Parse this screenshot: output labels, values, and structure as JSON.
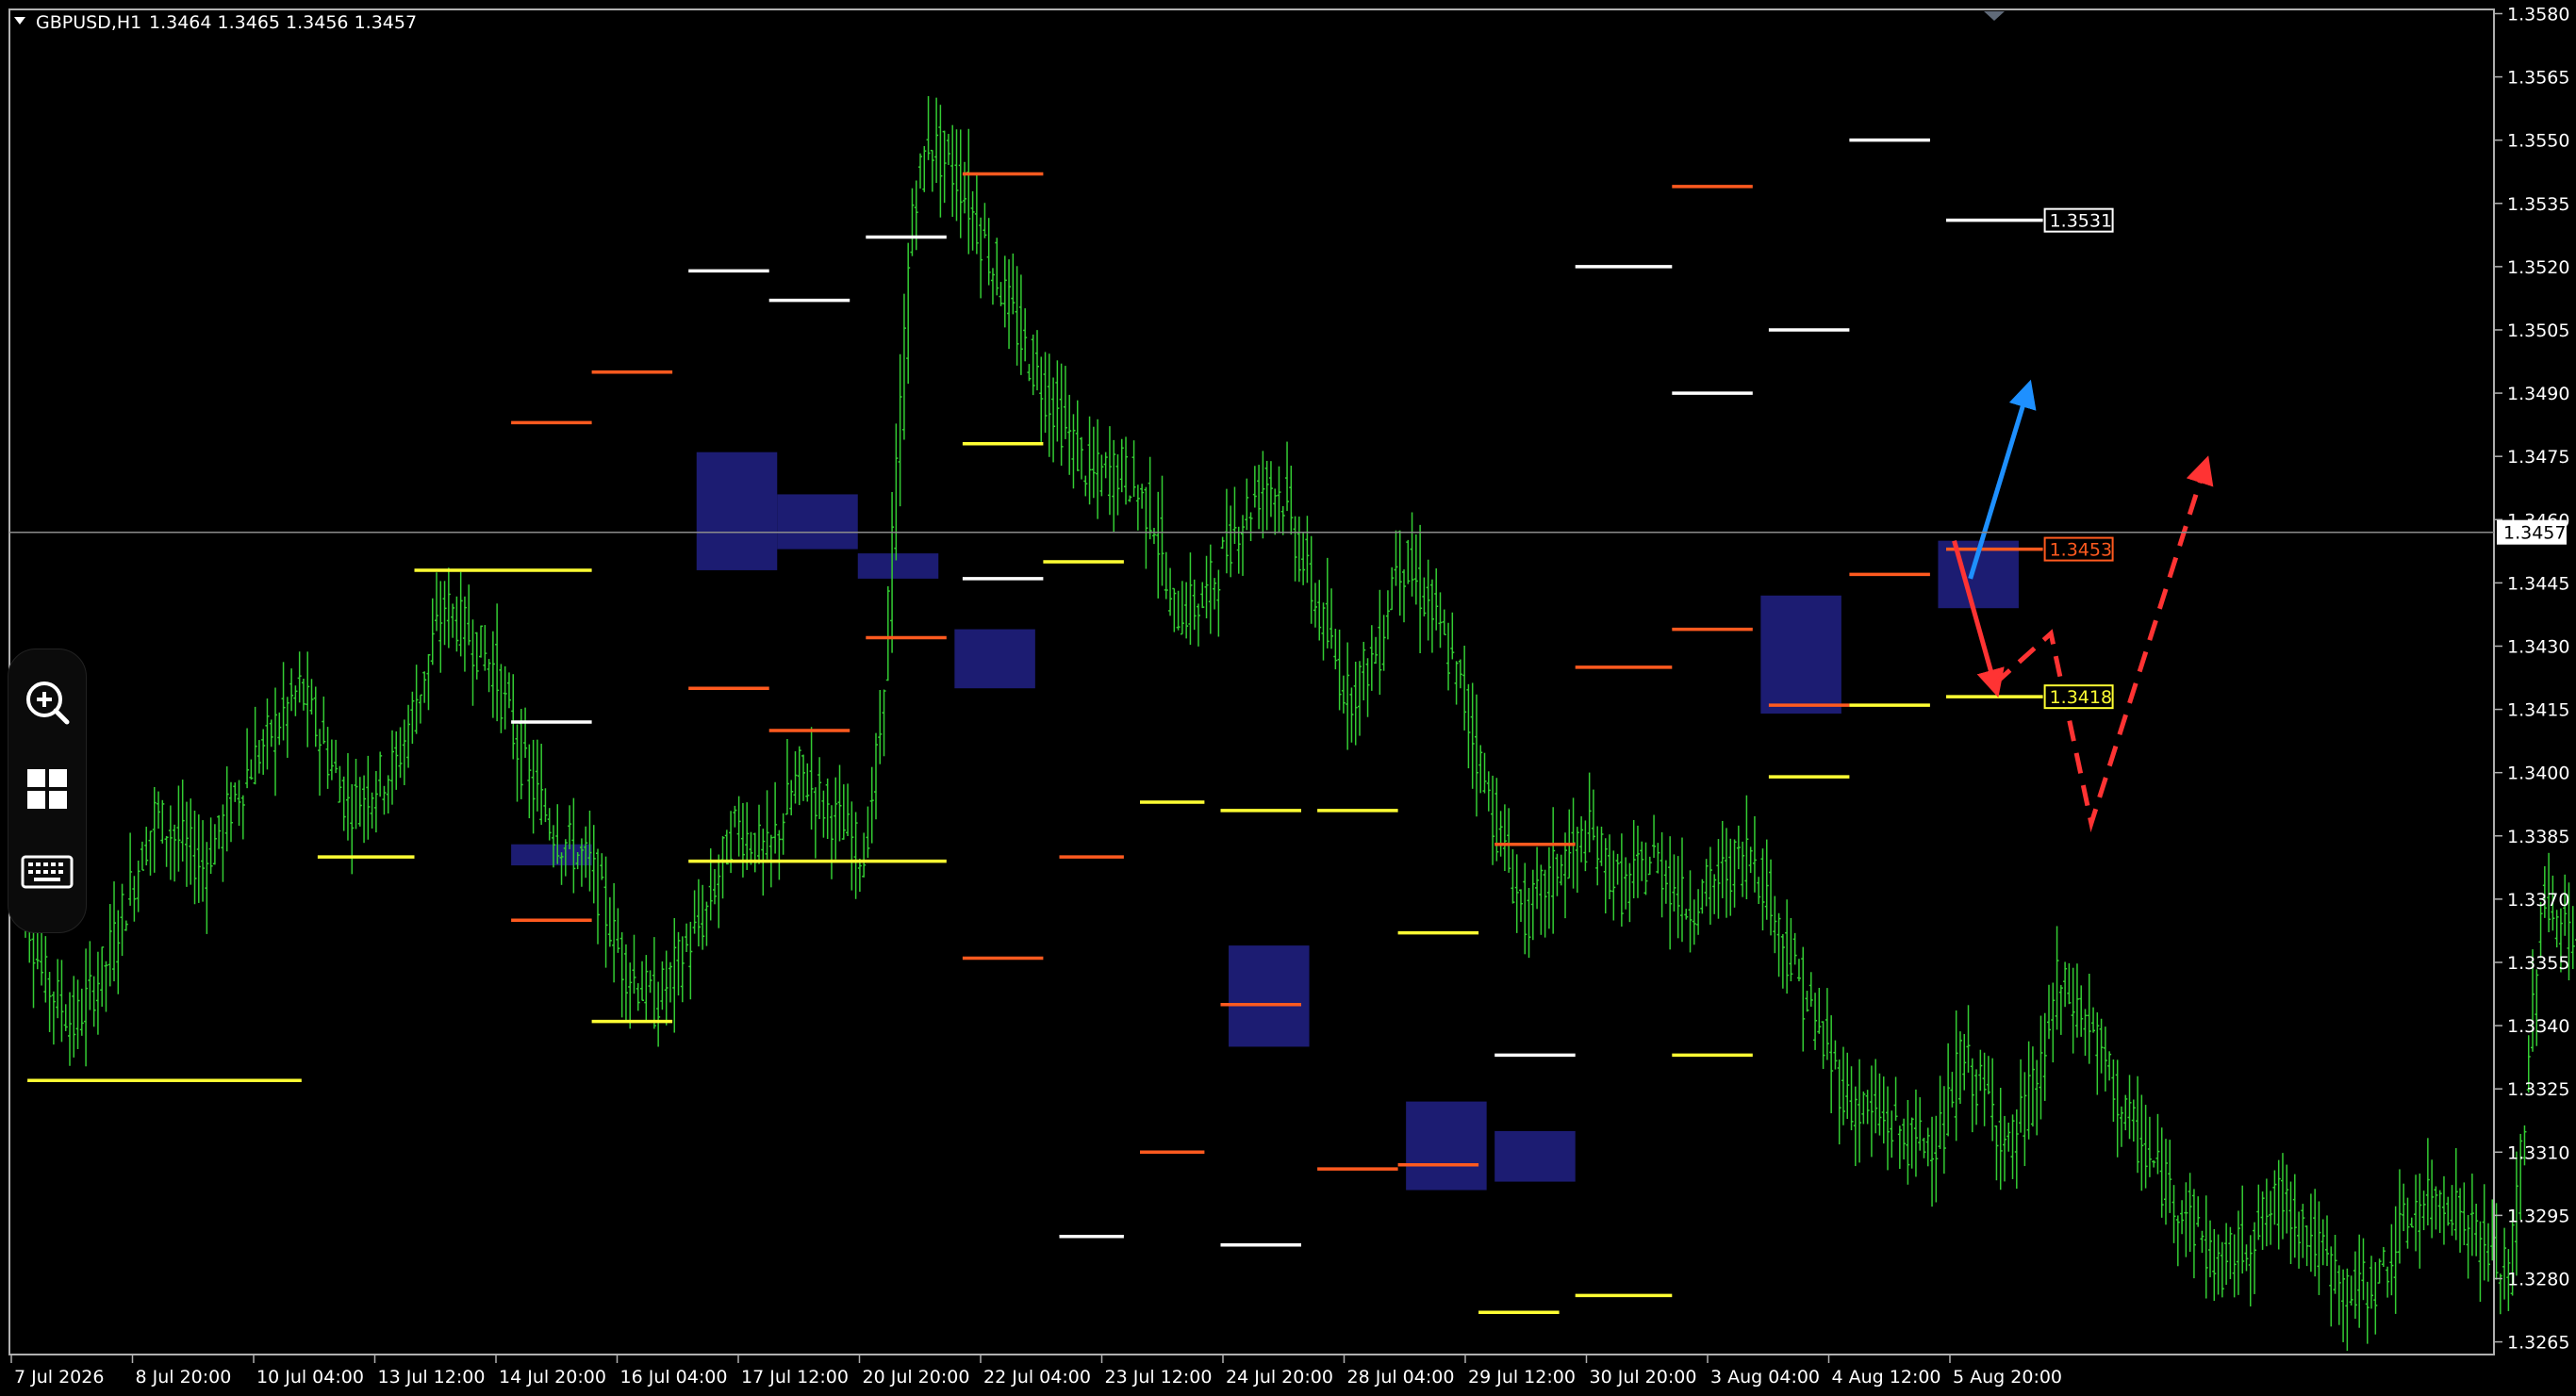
{
  "header": {
    "symbol_label": "GBPUSD,H1",
    "ohlc": "1.3464 1.3465 1.3456 1.3457"
  },
  "toolbar": {
    "icons": [
      "zoom-in-icon",
      "grid-icon",
      "keyboard-icon"
    ]
  },
  "chart_data": {
    "type": "candlestick",
    "symbol": "GBPUSD",
    "timeframe": "H1",
    "ohlc_last": {
      "open": 1.3464,
      "high": 1.3465,
      "low": 1.3456,
      "close": 1.3457
    },
    "ylim": [
      1.3262,
      1.3581
    ],
    "y_ticks": [
      "1.3580",
      "1.3565",
      "1.3550",
      "1.3535",
      "1.3520",
      "1.3505",
      "1.3490",
      "1.3475",
      "1.3460",
      "1.3445",
      "1.3430",
      "1.3415",
      "1.3400",
      "1.3385",
      "1.3370",
      "1.3355",
      "1.3340",
      "1.3325",
      "1.3310",
      "1.3295",
      "1.3280",
      "1.3265"
    ],
    "x_ticks": [
      "7 Jul 2026",
      "8 Jul 20:00",
      "10 Jul 04:00",
      "13 Jul 12:00",
      "14 Jul 20:00",
      "16 Jul 04:00",
      "17 Jul 12:00",
      "20 Jul 20:00",
      "22 Jul 04:00",
      "23 Jul 12:00",
      "24 Jul 20:00",
      "28 Jul 04:00",
      "29 Jul 12:00",
      "30 Jul 20:00",
      "3 Aug 04:00",
      "4 Aug 12:00",
      "5 Aug 20:00"
    ],
    "current_price": {
      "value": 1.3457,
      "label": "1.3457"
    },
    "price_labels": [
      {
        "value": 1.3531,
        "label": "1.3531",
        "color": "#ffffff"
      },
      {
        "value": 1.3453,
        "label": "1.3453",
        "color": "#ff5a1f"
      },
      {
        "value": 1.3418,
        "label": "1.3418",
        "color": "#ffff33"
      }
    ],
    "colors": {
      "candles": "#33cc33",
      "resistance": "#ffffff",
      "pivot": "#ff5a1f",
      "support": "#ffff33",
      "zones": "#1e1e78",
      "up_arrow": "#1e90ff",
      "down_arrow": "#ff3333"
    },
    "price_path": [
      [
        0,
        1.3385
      ],
      [
        2,
        1.3352
      ],
      [
        4,
        1.334
      ],
      [
        6,
        1.3355
      ],
      [
        9,
        1.339
      ],
      [
        12,
        1.3378
      ],
      [
        15,
        1.3402
      ],
      [
        18,
        1.342
      ],
      [
        21,
        1.3392
      ],
      [
        24,
        1.3402
      ],
      [
        27,
        1.344
      ],
      [
        30,
        1.3425
      ],
      [
        32,
        1.34
      ],
      [
        34,
        1.3385
      ],
      [
        36,
        1.3378
      ],
      [
        38,
        1.3355
      ],
      [
        40,
        1.3345
      ],
      [
        43,
        1.3365
      ],
      [
        45,
        1.3388
      ],
      [
        47,
        1.338
      ],
      [
        49,
        1.34
      ],
      [
        51,
        1.339
      ],
      [
        53,
        1.338
      ],
      [
        54,
        1.341
      ],
      [
        55,
        1.347
      ],
      [
        56,
        1.3535
      ],
      [
        57,
        1.355
      ],
      [
        59,
        1.354
      ],
      [
        61,
        1.352
      ],
      [
        63,
        1.35
      ],
      [
        65,
        1.3485
      ],
      [
        67,
        1.347
      ],
      [
        69,
        1.3472
      ],
      [
        71,
        1.346
      ],
      [
        72,
        1.3438
      ],
      [
        74,
        1.344
      ],
      [
        76,
        1.3458
      ],
      [
        78,
        1.347
      ],
      [
        79,
        1.3465
      ],
      [
        81,
        1.344
      ],
      [
        83,
        1.3418
      ],
      [
        85,
        1.343
      ],
      [
        86,
        1.3452
      ],
      [
        88,
        1.344
      ],
      [
        90,
        1.342
      ],
      [
        92,
        1.339
      ],
      [
        94,
        1.3365
      ],
      [
        96,
        1.3378
      ],
      [
        98,
        1.3385
      ],
      [
        100,
        1.3372
      ],
      [
        102,
        1.338
      ],
      [
        104,
        1.3368
      ],
      [
        106,
        1.3375
      ],
      [
        108,
        1.3382
      ],
      [
        110,
        1.336
      ],
      [
        112,
        1.334
      ],
      [
        114,
        1.3322
      ],
      [
        116,
        1.3318
      ],
      [
        118,
        1.3312
      ],
      [
        120,
        1.3315
      ],
      [
        121,
        1.3333
      ],
      [
        123,
        1.332
      ],
      [
        124,
        1.331
      ],
      [
        126,
        1.333
      ],
      [
        127,
        1.335
      ],
      [
        129,
        1.334
      ],
      [
        131,
        1.332
      ],
      [
        133,
        1.3306
      ],
      [
        135,
        1.3296
      ],
      [
        137,
        1.3282
      ],
      [
        139,
        1.329
      ],
      [
        141,
        1.33
      ],
      [
        143,
        1.3288
      ],
      [
        145,
        1.3276
      ],
      [
        147,
        1.328
      ],
      [
        149,
        1.3296
      ],
      [
        151,
        1.33
      ],
      [
        153,
        1.329
      ],
      [
        155,
        1.328
      ],
      [
        156,
        1.332
      ],
      [
        157,
        1.337
      ],
      [
        158,
        1.3365
      ],
      [
        159,
        1.336
      ],
      [
        160,
        1.3345
      ],
      [
        162,
        1.334
      ],
      [
        163,
        1.336
      ],
      [
        165,
        1.339
      ],
      [
        166,
        1.3435
      ],
      [
        168,
        1.347
      ],
      [
        170,
        1.346
      ],
      [
        172,
        1.3452
      ],
      [
        174,
        1.344
      ],
      [
        175,
        1.346
      ],
      [
        177,
        1.343
      ],
      [
        178,
        1.341
      ],
      [
        179,
        1.344
      ],
      [
        181,
        1.346
      ],
      [
        183,
        1.3478
      ],
      [
        185,
        1.3495
      ],
      [
        187,
        1.3482
      ],
      [
        189,
        1.3465
      ],
      [
        191,
        1.3455
      ],
      [
        193,
        1.3445
      ],
      [
        195,
        1.342
      ],
      [
        197,
        1.3428
      ],
      [
        199,
        1.3435
      ],
      [
        201,
        1.3418
      ],
      [
        203,
        1.3425
      ],
      [
        205,
        1.344
      ],
      [
        207,
        1.3445
      ],
      [
        209,
        1.345
      ],
      [
        211,
        1.3453
      ],
      [
        213,
        1.3465
      ],
      [
        215,
        1.3472
      ],
      [
        217,
        1.3468
      ],
      [
        219,
        1.3465
      ],
      [
        220,
        1.3457
      ]
    ],
    "levels": [
      {
        "kind": "support",
        "value": 1.3327,
        "x0": 1,
        "x1": 18
      },
      {
        "kind": "support",
        "value": 1.338,
        "x0": 19,
        "x1": 25
      },
      {
        "kind": "support",
        "value": 1.3448,
        "x0": 25,
        "x1": 36
      },
      {
        "kind": "resistance",
        "value": 1.3412,
        "x0": 31,
        "x1": 36
      },
      {
        "kind": "pivot",
        "value": 1.3483,
        "x0": 31,
        "x1": 36
      },
      {
        "kind": "pivot",
        "value": 1.3365,
        "x0": 31,
        "x1": 36
      },
      {
        "kind": "support",
        "value": 1.3341,
        "x0": 36,
        "x1": 41
      },
      {
        "kind": "pivot",
        "value": 1.3495,
        "x0": 36,
        "x1": 41
      },
      {
        "kind": "resistance",
        "value": 1.3519,
        "x0": 42,
        "x1": 47
      },
      {
        "kind": "pivot",
        "value": 1.342,
        "x0": 42,
        "x1": 47
      },
      {
        "kind": "support",
        "value": 1.3379,
        "x0": 42,
        "x1": 58
      },
      {
        "kind": "resistance",
        "value": 1.3512,
        "x0": 47,
        "x1": 52
      },
      {
        "kind": "pivot",
        "value": 1.341,
        "x0": 47,
        "x1": 52
      },
      {
        "kind": "resistance",
        "value": 1.3527,
        "x0": 53,
        "x1": 58
      },
      {
        "kind": "pivot",
        "value": 1.3432,
        "x0": 53,
        "x1": 58
      },
      {
        "kind": "pivot",
        "value": 1.3542,
        "x0": 59,
        "x1": 64
      },
      {
        "kind": "resistance",
        "value": 1.3446,
        "x0": 59,
        "x1": 64
      },
      {
        "kind": "pivot",
        "value": 1.3356,
        "x0": 59,
        "x1": 64
      },
      {
        "kind": "support",
        "value": 1.3478,
        "x0": 59,
        "x1": 64
      },
      {
        "kind": "support",
        "value": 1.345,
        "x0": 64,
        "x1": 69
      },
      {
        "kind": "pivot",
        "value": 1.338,
        "x0": 65,
        "x1": 69
      },
      {
        "kind": "resistance",
        "value": 1.329,
        "x0": 65,
        "x1": 69
      },
      {
        "kind": "support",
        "value": 1.3393,
        "x0": 70,
        "x1": 74
      },
      {
        "kind": "pivot",
        "value": 1.331,
        "x0": 70,
        "x1": 74
      },
      {
        "kind": "support",
        "value": 1.3391,
        "x0": 75,
        "x1": 80
      },
      {
        "kind": "pivot",
        "value": 1.3345,
        "x0": 75,
        "x1": 80
      },
      {
        "kind": "resistance",
        "value": 1.3288,
        "x0": 75,
        "x1": 80
      },
      {
        "kind": "support",
        "value": 1.3391,
        "x0": 81,
        "x1": 86
      },
      {
        "kind": "pivot",
        "value": 1.3306,
        "x0": 81,
        "x1": 86
      },
      {
        "kind": "support",
        "value": 1.3362,
        "x0": 86,
        "x1": 91
      },
      {
        "kind": "pivot",
        "value": 1.3307,
        "x0": 86,
        "x1": 91
      },
      {
        "kind": "support",
        "value": 1.3272,
        "x0": 91,
        "x1": 96
      },
      {
        "kind": "pivot",
        "value": 1.3383,
        "x0": 92,
        "x1": 97
      },
      {
        "kind": "resistance",
        "value": 1.3333,
        "x0": 92,
        "x1": 97
      },
      {
        "kind": "support",
        "value": 1.3276,
        "x0": 97,
        "x1": 103
      },
      {
        "kind": "resistance",
        "value": 1.352,
        "x0": 97,
        "x1": 103
      },
      {
        "kind": "pivot",
        "value": 1.3425,
        "x0": 97,
        "x1": 103
      },
      {
        "kind": "pivot",
        "value": 1.3539,
        "x0": 103,
        "x1": 108
      },
      {
        "kind": "resistance",
        "value": 1.349,
        "x0": 103,
        "x1": 108
      },
      {
        "kind": "pivot",
        "value": 1.3434,
        "x0": 103,
        "x1": 108
      },
      {
        "kind": "support",
        "value": 1.3333,
        "x0": 103,
        "x1": 108
      },
      {
        "kind": "resistance",
        "value": 1.3505,
        "x0": 109,
        "x1": 114
      },
      {
        "kind": "pivot",
        "value": 1.3416,
        "x0": 109,
        "x1": 114
      },
      {
        "kind": "support",
        "value": 1.3399,
        "x0": 109,
        "x1": 114
      },
      {
        "kind": "resistance",
        "value": 1.355,
        "x0": 114,
        "x1": 119
      },
      {
        "kind": "pivot",
        "value": 1.3447,
        "x0": 114,
        "x1": 119
      },
      {
        "kind": "support",
        "value": 1.3416,
        "x0": 114,
        "x1": 119
      },
      {
        "kind": "resistance",
        "value": 1.3531,
        "x0": 120,
        "x1": 126
      },
      {
        "kind": "pivot",
        "value": 1.3453,
        "x0": 120,
        "x1": 126
      },
      {
        "kind": "support",
        "value": 1.3418,
        "x0": 120,
        "x1": 126
      }
    ],
    "zones": [
      {
        "x0": 42.5,
        "x1": 47.5,
        "y0": 1.3448,
        "y1": 1.3476
      },
      {
        "x0": 47.5,
        "x1": 52.5,
        "y0": 1.3453,
        "y1": 1.3466
      },
      {
        "x0": 52.5,
        "x1": 57.5,
        "y0": 1.3446,
        "y1": 1.3452
      },
      {
        "x0": 58.5,
        "x1": 63.5,
        "y0": 1.342,
        "y1": 1.3434
      },
      {
        "x0": 31,
        "x1": 36,
        "y0": 1.3378,
        "y1": 1.3383
      },
      {
        "x0": 75.5,
        "x1": 80.5,
        "y0": 1.3335,
        "y1": 1.3359
      },
      {
        "x0": 86.5,
        "x1": 91.5,
        "y0": 1.3301,
        "y1": 1.3322
      },
      {
        "x0": 92,
        "x1": 97,
        "y0": 1.3303,
        "y1": 1.3315
      },
      {
        "x0": 108.5,
        "x1": 113.5,
        "y0": 1.3414,
        "y1": 1.3442
      },
      {
        "x0": 119.5,
        "x1": 124.5,
        "y0": 1.3439,
        "y1": 1.3455
      }
    ],
    "forecast": {
      "up_arrow": [
        [
          121.5,
          1.3446
        ],
        [
          125,
          1.349
        ]
      ],
      "down_arrow": [
        [
          120.5,
          1.3455
        ],
        [
          123,
          1.3421
        ]
      ],
      "dashed_path": [
        [
          123,
          1.3421
        ],
        [
          126.5,
          1.3433
        ],
        [
          129,
          1.3388
        ],
        [
          136,
          1.3472
        ]
      ]
    }
  }
}
